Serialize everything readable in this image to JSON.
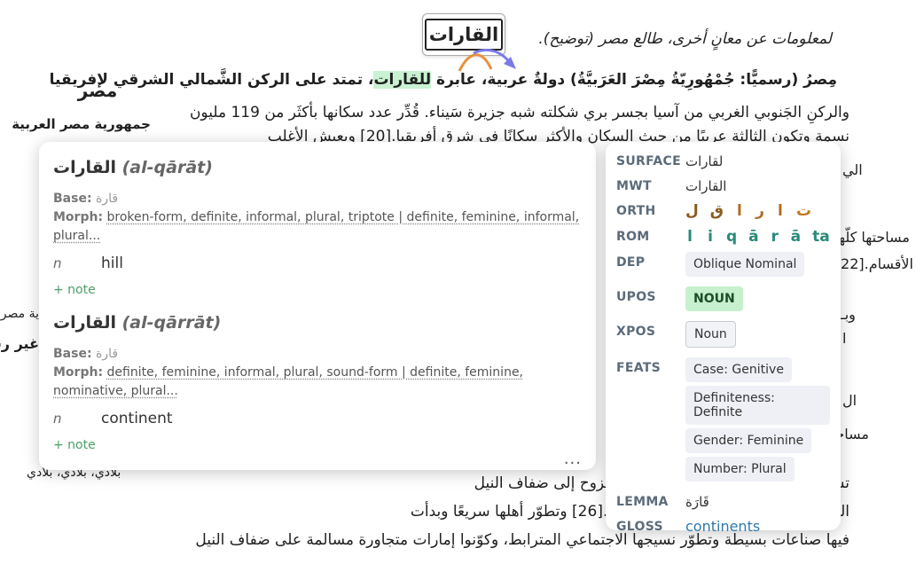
{
  "article": {
    "note_line": "لمعلومات عن معانٍ أخرى، طالع مصر (توضيح).",
    "lead_before": "مِصرُ (رسميًّا: جُمْهُورِيّةُ مِصْرَ العَرَبيَّةُ) دولةٌ عربية، عابرة ",
    "lead_highlight": "للقارات",
    "lead_after": "، تمتد على الركن الشَّمالي الشرقي لإفريقيا",
    "line2": "والركنِ الجَنوبي الغربي من آسيا بجسر بري شكلته شبه جزيرة سَيناء. قُدِّر عدد سكانها بأكثَر من 119 مليون",
    "line3": "نسمة وتكون الثالثة عربيًا من حيث السكان والأكثر سكانًا في شرق أفريقيا.[20] ويعيش الأغلب",
    "frag_a": "الي",
    "frag_b": "مساحتها كلّها",
    "frag_c": "الأقسام.[22]",
    "frag_d": "وبـ",
    "frag_e": "ا",
    "frag_f": "ال",
    "frag_g": "مساحة",
    "line_lower1": "تش                        على وجه الأرض حيث بدأ البشر بالنزوح إلى ضفاف النيل",
    "line_lower2": "الزراعية الماشية منذ نحو 10,000 سنة.[26] وتطوّر أهلها سريعًا وبدأت",
    "line_lower3": "فيها صناعات بسيطة وتطوّر نسيجها الاجتماعي المترابط، وكوّنوا إمارات متجاورة مسالمة على ضفاف النيل"
  },
  "infobox": {
    "title": "مصر",
    "subtitle": "جمهورية مصر العربية",
    "frag1": "ية مصر",
    "frag2": "غير رس",
    "frag3": "بلادي، بلادي، بلادي"
  },
  "bubble": {
    "word": "القارات"
  },
  "dictionary": {
    "entries": [
      {
        "word": "القارات",
        "translit": "(al-qārāt)",
        "base_label": "Base:",
        "base": "قارة",
        "morph_label": "Morph:",
        "morph": "broken-form, definite, informal, plural, triptote | definite, feminine, informal, plural...",
        "pos": "n",
        "gloss": "hill",
        "add_note": "+ note"
      },
      {
        "word": "القارات",
        "translit": "(al-qārrāt)",
        "base_label": "Base:",
        "base": "قارة",
        "morph_label": "Morph:",
        "morph": "definite, feminine, informal, plural, sound-form | definite, feminine, nominative, plural...",
        "pos": "n",
        "gloss": "continent",
        "add_note": "+ note"
      }
    ],
    "more": "..."
  },
  "properties": {
    "surface_label": "SURFACE",
    "surface": "لقارات",
    "mwt_label": "MWT",
    "mwt": "القارات",
    "orth_label": "ORTH",
    "orth_letters": [
      "ل",
      "ق",
      "ا",
      "ر",
      "ا",
      "ت"
    ],
    "orth_colors": [
      "#8a5a1e",
      "#8a5a1e",
      "#b06c22",
      "#b06c22",
      "#b06c22",
      "#c0781e"
    ],
    "rom_label": "ROM",
    "rom_letters": [
      "l",
      "i",
      "q",
      "ā",
      "r",
      "ā",
      "ta"
    ],
    "rom_color": "#2a8a7a",
    "dep_label": "DEP",
    "dep": "Oblique Nominal",
    "upos_label": "UPOS",
    "upos": "NOUN",
    "xpos_label": "XPOS",
    "xpos": "Noun",
    "feats_label": "FEATS",
    "feats": [
      "Case: Genitive",
      "Definiteness: Definite",
      "Gender: Feminine",
      "Number: Plural"
    ],
    "lemma_label": "LEMMA",
    "lemma": "قَارَة",
    "gloss_label": "GLOSS",
    "gloss": "continents"
  },
  "colors": {
    "highlight": "#c9f2d2",
    "upos_chip": "#c7f0cf",
    "note_green": "#4aa06a",
    "link_blue": "#2f78a8",
    "arrow_orange": "#e8913a",
    "arrow_purple": "#7a7ae8"
  }
}
